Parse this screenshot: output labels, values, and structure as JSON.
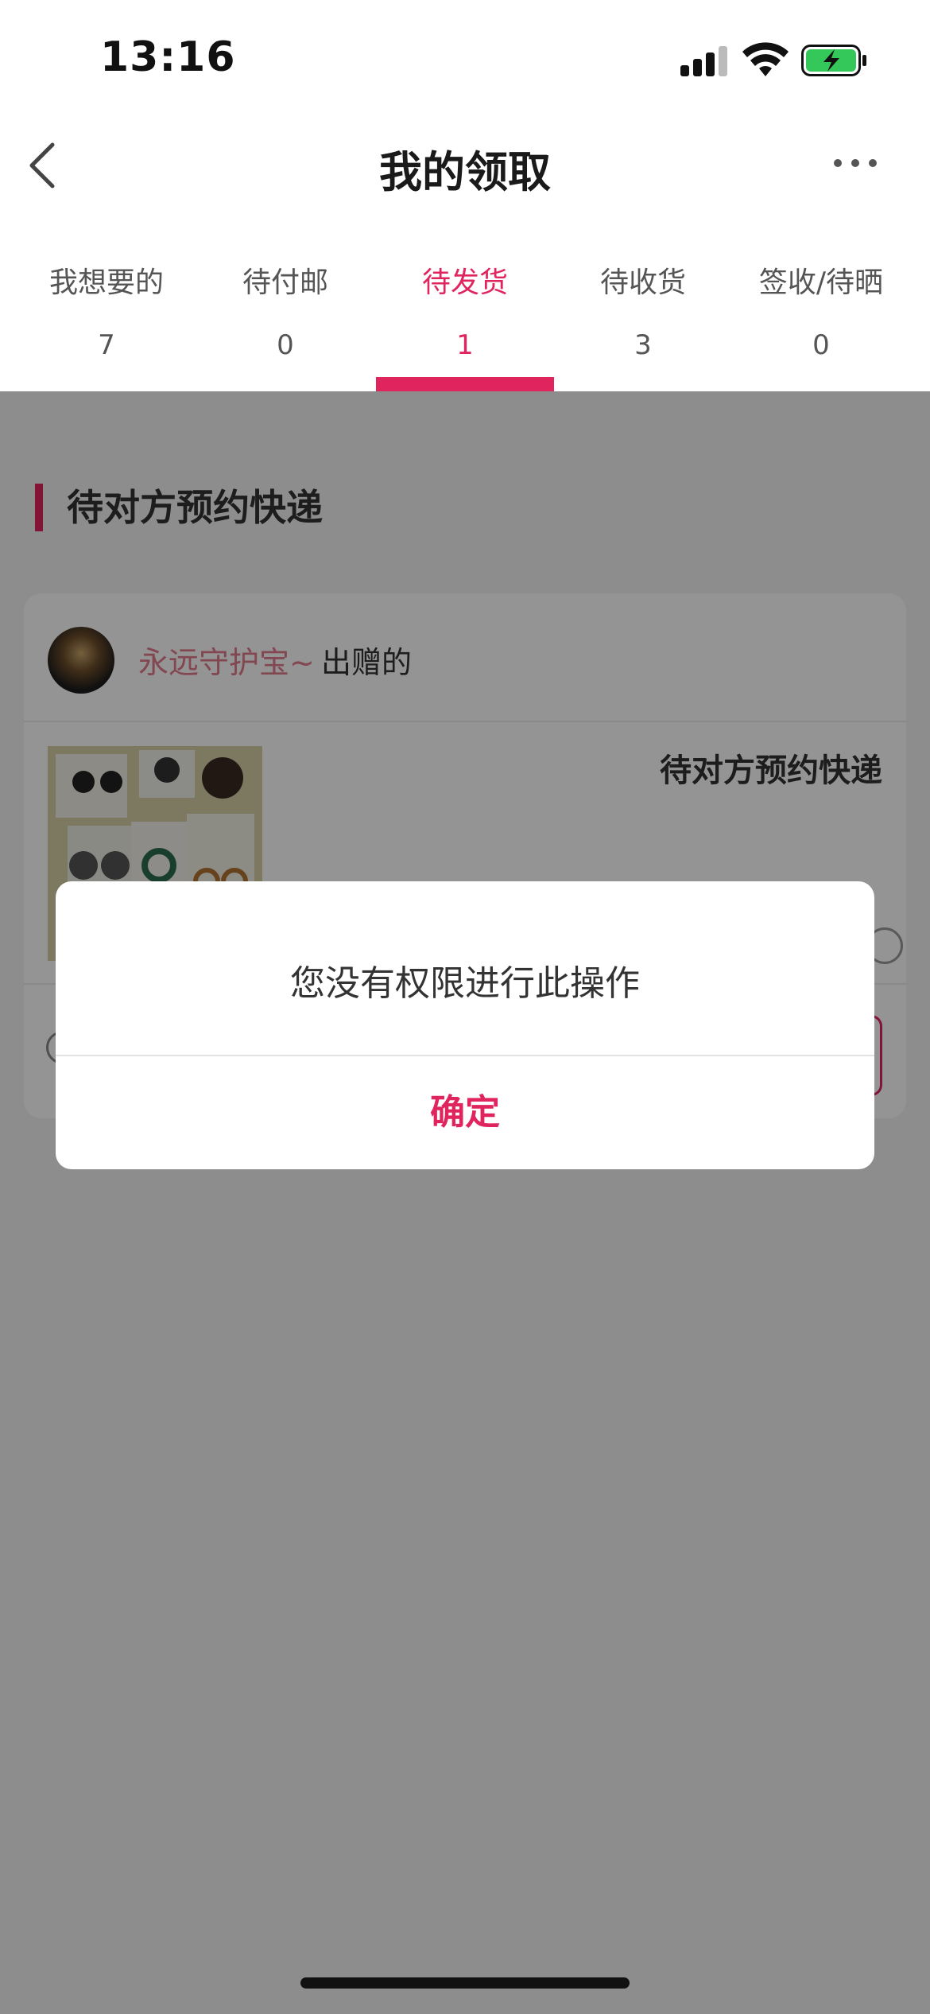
{
  "status_bar": {
    "time": "13:16"
  },
  "nav": {
    "title": "我的领取"
  },
  "tabs": [
    {
      "label": "我想要的",
      "count": "7"
    },
    {
      "label": "待付邮",
      "count": "0"
    },
    {
      "label": "待发货",
      "count": "1"
    },
    {
      "label": "待收货",
      "count": "3"
    },
    {
      "label": "签收/待晒",
      "count": "0"
    }
  ],
  "active_tab": 2,
  "section": {
    "title": "待对方预约快递"
  },
  "card": {
    "giver_name": "永远守护宝~",
    "giver_suffix": "出赠的",
    "status": "待对方预约快递"
  },
  "dialog": {
    "message": "您没有权限进行此操作",
    "confirm_label": "确定"
  },
  "colors": {
    "accent": "#e0245e",
    "giver_name": "#e07a8a"
  }
}
